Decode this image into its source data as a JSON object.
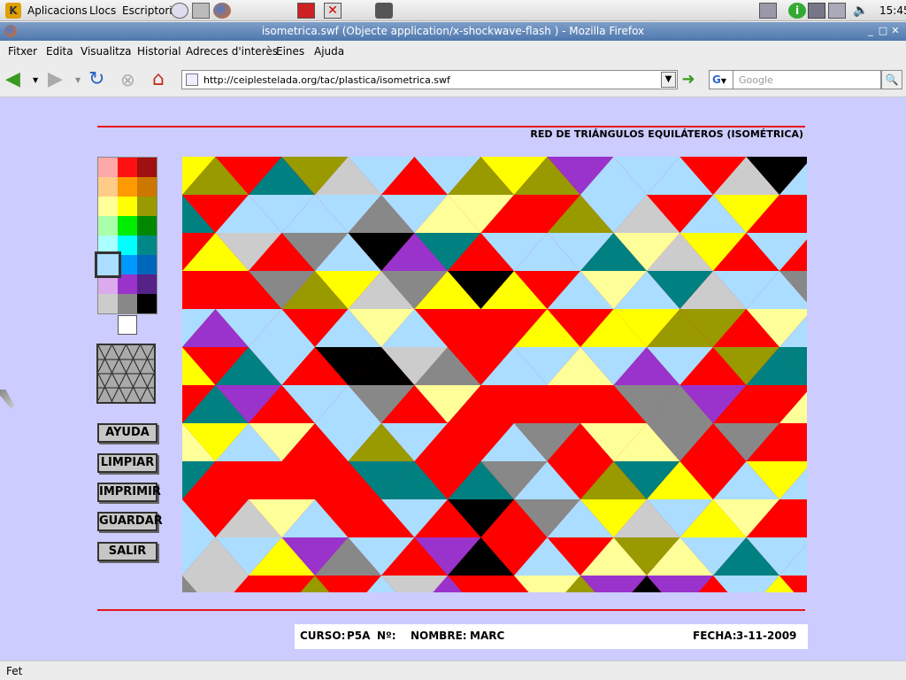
{
  "panel": {
    "menus": [
      "Aplicacions",
      "Llocs",
      "Escriptori"
    ],
    "clock": "15:45"
  },
  "window": {
    "title": "isometrica.swf (Objecte application/x-shockwave-flash ) - Mozilla Firefox"
  },
  "menubar": {
    "items": [
      "Fitxer",
      "Edita",
      "Visualitza",
      "Historial",
      "Adreces d'interès",
      "Eines",
      "Ajuda"
    ]
  },
  "navbar": {
    "url": "http://ceiplestelada.org/tac/plastica/isometrica.swf",
    "search_placeholder": "Google"
  },
  "app": {
    "heading": "RED DE TRIÁNGULOS EQUILÁTEROS (ISOMÉTRICA)",
    "buttons": [
      "AYUDA",
      "LIMPIAR",
      "IMPRIMIR",
      "GUARDAR",
      "SALIR"
    ],
    "palette": [
      "#ffa8a8",
      "#ff1111",
      "#a01010",
      "#ffcc88",
      "#ff9900",
      "#cc7700",
      "#ffff99",
      "#ffff00",
      "#999900",
      "#aaffaa",
      "#00ee00",
      "#008800",
      "#aaffff",
      "#00ffff",
      "#008888",
      "#aaddff",
      "#0099ff",
      "#0066bb",
      "#ddaaee",
      "#9933cc",
      "#552288",
      "#cccccc",
      "#888888",
      "#000000"
    ],
    "selected_color": "#aaddff",
    "white_swatch": "#ffffff",
    "footer": {
      "curso_label": "CURSO:",
      "curso_value": "P5A",
      "num_label": "Nº:",
      "nombre_label": "NOMBRE:",
      "nombre_value": "MARC",
      "fecha_label": "FECHA:",
      "fecha_value": "3-11-2009"
    }
  },
  "statusbar": {
    "text": "Fet"
  }
}
